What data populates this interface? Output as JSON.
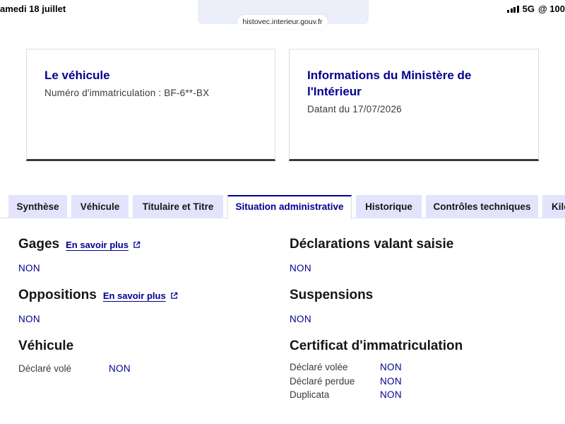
{
  "status_bar": {
    "time": "amedi 18 juillet",
    "network": "5G",
    "right_text": "@ 100"
  },
  "browser": {
    "url": "histovec.interieur.gouv.fr"
  },
  "cards": {
    "vehicle": {
      "title": "Le véhicule",
      "subtitle": "Numéro d'immatriculation : BF-6**-BX"
    },
    "ministry": {
      "title": "Informations du Ministère de l'Intérieur",
      "subtitle": "Datant du 17/07/2026"
    }
  },
  "tabs": [
    {
      "label": "Synthèse"
    },
    {
      "label": "Véhicule"
    },
    {
      "label": "Titulaire et Titre"
    },
    {
      "label": "Situation administrative"
    },
    {
      "label": "Historique"
    },
    {
      "label": "Contrôles techniques"
    },
    {
      "label": "Kilométrage"
    }
  ],
  "active_tab": "Situation administrative",
  "left": {
    "gages": {
      "title": "Gages",
      "link": "En savoir plus",
      "value": "NON"
    },
    "oppositions": {
      "title": "Oppositions",
      "link": "En savoir plus",
      "value": "NON"
    },
    "vehicule": {
      "title": "Véhicule",
      "rows": [
        {
          "label": "Déclaré volé",
          "value": "NON"
        }
      ]
    }
  },
  "right": {
    "declarations": {
      "title": "Déclarations valant saisie",
      "value": "NON"
    },
    "suspensions": {
      "title": "Suspensions",
      "value": "NON"
    },
    "certificat": {
      "title": "Certificat d'immatriculation",
      "rows": [
        {
          "label": "Déclaré volée",
          "value": "NON"
        },
        {
          "label": "Déclaré perdue",
          "value": "NON"
        },
        {
          "label": "Duplicata",
          "value": "NON"
        }
      ]
    }
  },
  "colors": {
    "accent": "#000091",
    "tab_bg": "#e3e3fd",
    "card_border_bottom": "#3a3a3a"
  }
}
